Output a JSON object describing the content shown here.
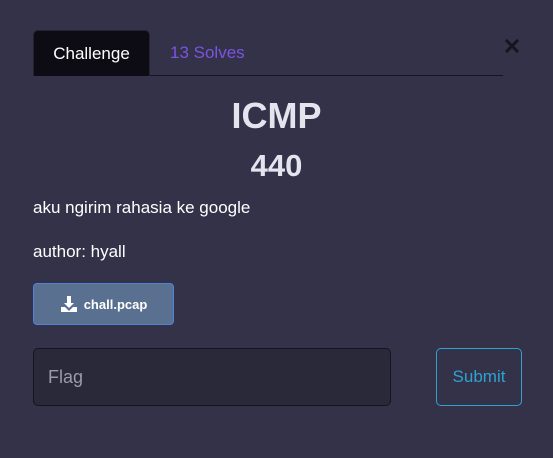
{
  "tabs": {
    "challenge_label": "Challenge",
    "solves_label": "13 Solves"
  },
  "close_icon": "close-icon",
  "challenge": {
    "name": "ICMP",
    "points": "440",
    "description": "aku ngirim rahasia ke google",
    "author": "author: hyall"
  },
  "file": {
    "name": "chall.pcap",
    "icon": "download-icon"
  },
  "flag_input": {
    "placeholder": "Flag",
    "value": ""
  },
  "submit": {
    "label": "Submit"
  },
  "colors": {
    "background": "#343249",
    "tab_active": "#0d0c15",
    "solves_link": "#7b54e0",
    "file_button": "#5a7090",
    "submit_accent": "#2fa2d0"
  }
}
